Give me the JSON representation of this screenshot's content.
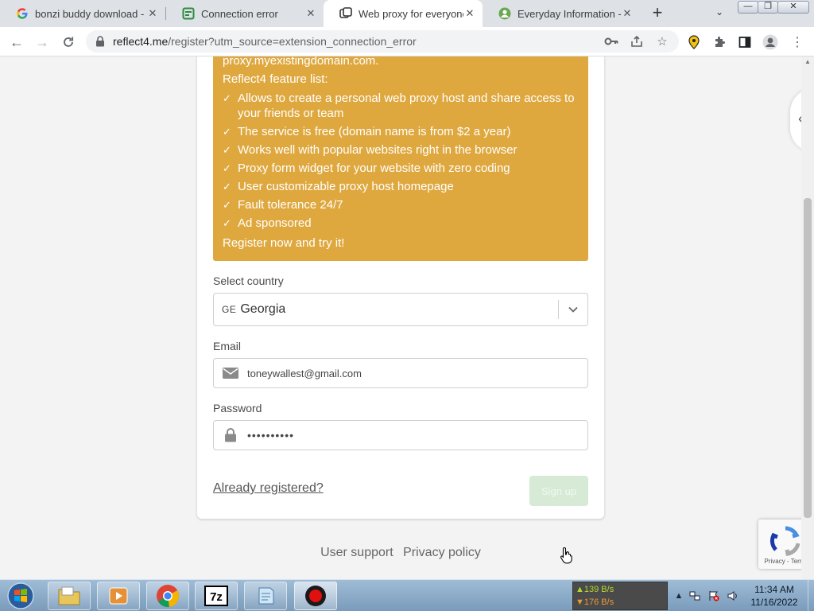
{
  "tabs": [
    {
      "title": "bonzi buddy download -",
      "icon": "google-icon"
    },
    {
      "title": "Connection error",
      "icon": "green-page-icon"
    },
    {
      "title": "Web proxy for everyone!",
      "icon": "reflect4-icon"
    },
    {
      "title": "Everyday Information - C",
      "icon": "profile-icon"
    }
  ],
  "address_bar": {
    "host": "reflect4.me",
    "path": "/register?utm_source=extension_connection_error"
  },
  "banner": {
    "top_line": "proxy.myexistingdomain.com.",
    "feature_title": "Reflect4 feature list:",
    "features": [
      "Allows to create a personal web proxy host and share access to your friends or team",
      "The service is free (domain name is from $2 a year)",
      "Works well with popular websites right in the browser",
      "Proxy form widget for your website with zero coding",
      "User customizable proxy host homepage",
      "Fault tolerance 24/7",
      "Ad sponsored"
    ],
    "cta": "Register now and try it!"
  },
  "form": {
    "country_label": "Select country",
    "country_code": "GE",
    "country_value": "Georgia",
    "email_label": "Email",
    "email_value": "toneywallest@gmail.com",
    "password_label": "Password",
    "password_value": "••••••••••",
    "already_registered": "Already registered?",
    "signup_label": "Sign up"
  },
  "footer": {
    "user_support": "User support",
    "privacy_policy": "Privacy policy"
  },
  "recaptcha": {
    "privacy": "Privacy",
    "separator": " - ",
    "terms": "Terms"
  },
  "taskbar": {
    "net_up": "▲139 B/s",
    "net_down": "▼176 B/s",
    "time": "11:34 AM",
    "date": "11/16/2022"
  },
  "colors": {
    "banner": "#dfa83f",
    "signup_disabled": "#d6ead6",
    "tab_active": "#ffffff",
    "tabstrip": "#dee1e6"
  }
}
